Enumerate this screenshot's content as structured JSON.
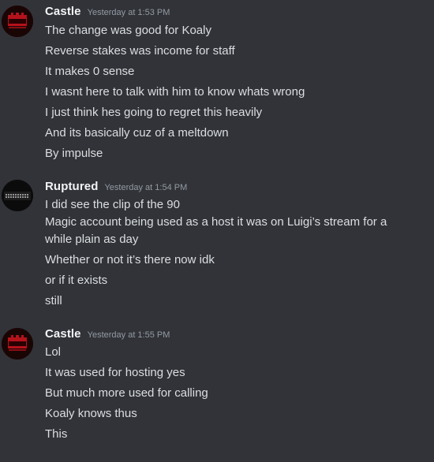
{
  "groups": [
    {
      "author": "Castle",
      "timestamp": "Yesterday at 1:53 PM",
      "avatar_icon": "castle-logo-avatar",
      "messages": [
        "The change was good for Koaly",
        "Reverse stakes was income for staff",
        "It makes 0 sense",
        "I wasnt here to talk with him to know whats wrong",
        "I just think hes going to regret this heavily",
        "And its basically cuz of a meltdown",
        "By impulse"
      ]
    },
    {
      "author": "Ruptured",
      "timestamp": "Yesterday at 1:54 PM",
      "avatar_icon": "ruptured-logo-avatar",
      "messages": [
        "I did see the clip of the 90",
        "Magic account being used as a host it was on Luigi’s stream for a while plain as day",
        "Whether or not it’s there now idk",
        "or if it exists",
        "still"
      ]
    },
    {
      "author": "Castle",
      "timestamp": "Yesterday at 1:55 PM",
      "avatar_icon": "castle-logo-avatar",
      "messages": [
        "Lol",
        "It was used for hosting yes",
        "But much more used for calling",
        "Koaly knows thus",
        "This"
      ]
    }
  ],
  "colors": {
    "background": "#313338",
    "username": "#f2f3f5",
    "text": "#dbdee1",
    "timestamp": "#949ba4"
  }
}
